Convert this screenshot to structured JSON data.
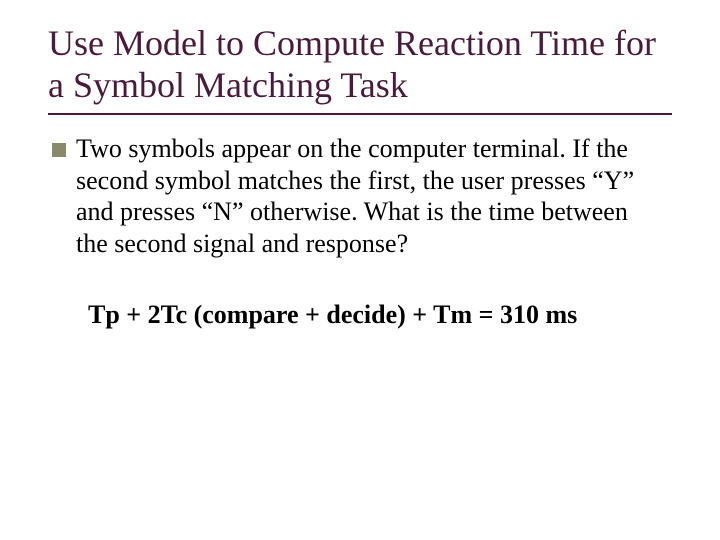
{
  "title": "Use Model to Compute Reaction Time for a Symbol Matching Task",
  "bullet": "Two symbols appear on the computer terminal. If the second symbol matches the first, the user presses “Y” and presses “N” otherwise. What is the time between the second signal and response?",
  "formula": "Tp + 2Tc (compare + decide) + Tm = 310 ms"
}
